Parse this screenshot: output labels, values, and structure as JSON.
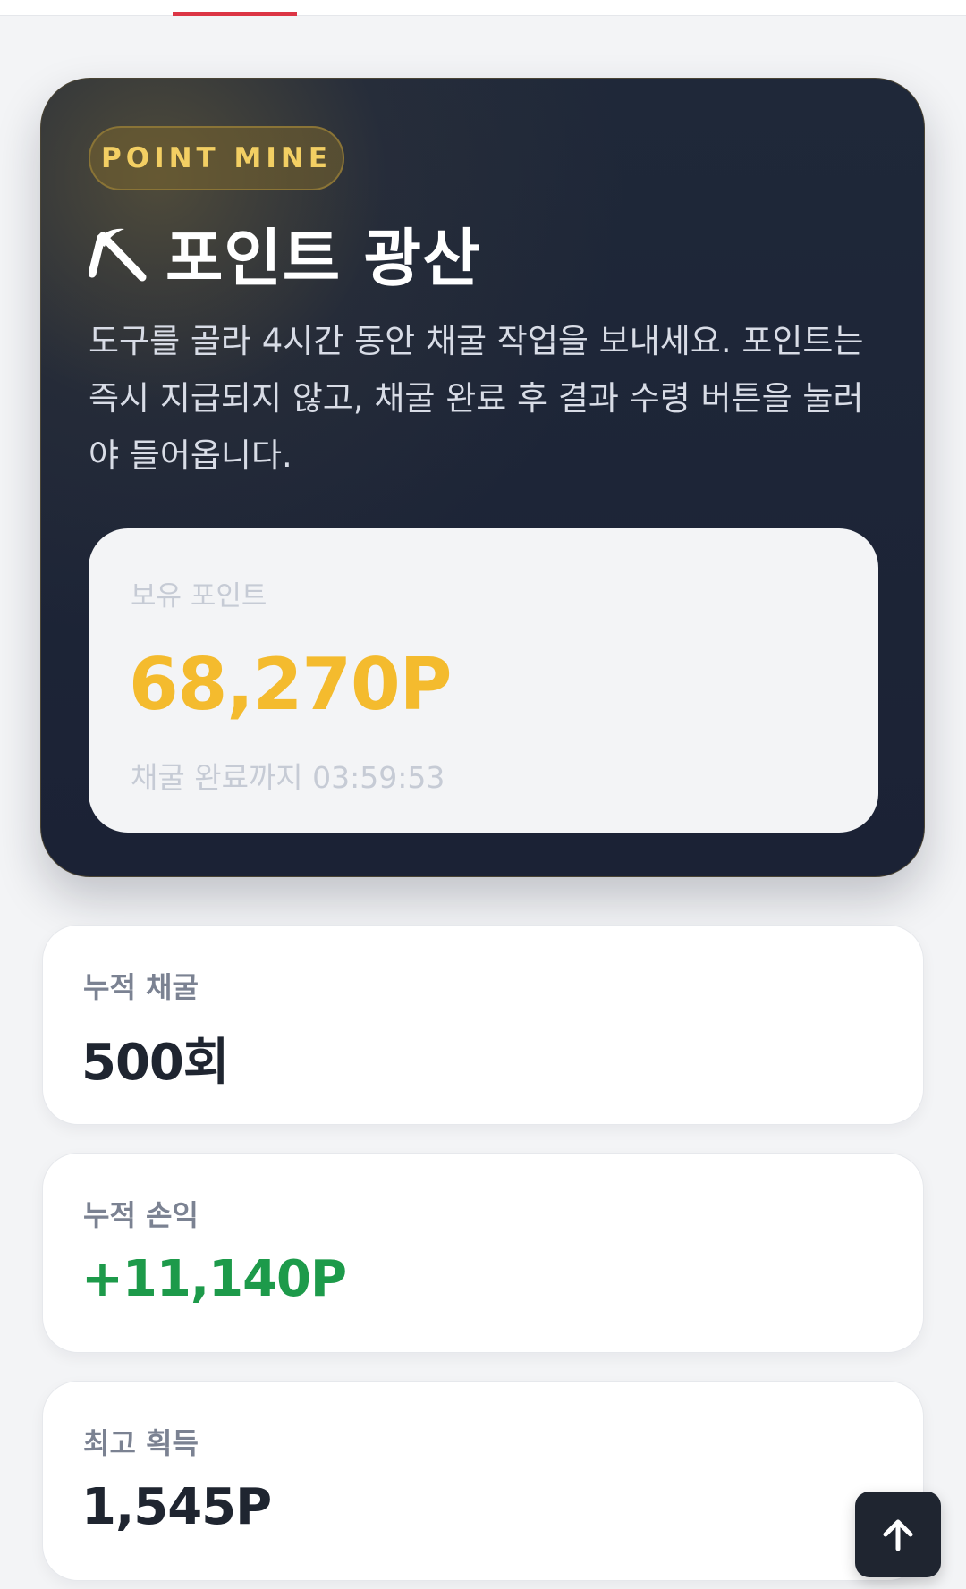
{
  "hero": {
    "badge": "POINT MINE",
    "icon": "pickaxe-icon",
    "title": "포인트 광산",
    "description": "도구를 골라 4시간 동안 채굴 작업을 보내세요. 포인트는 즉시 지급되지 않고, 채굴 완료 후 결과 수령 버튼을 눌러야 들어옵니다."
  },
  "points": {
    "label": "보유 포인트",
    "value": "68,270P",
    "timer": "채굴 완료까지 03:59:53"
  },
  "stats": [
    {
      "label": "누적 채굴",
      "value": "500회"
    },
    {
      "label": "누적 손익",
      "value": "+11,140P"
    },
    {
      "label": "최고 획득",
      "value": "1,545P"
    }
  ],
  "scroll_top": {
    "icon": "arrow-up-icon"
  },
  "colors": {
    "accent_gold": "#f4bb2e",
    "profit_green": "#1d9a4a",
    "tab_red": "#dc3545",
    "hero_bg": "#1f2839"
  }
}
